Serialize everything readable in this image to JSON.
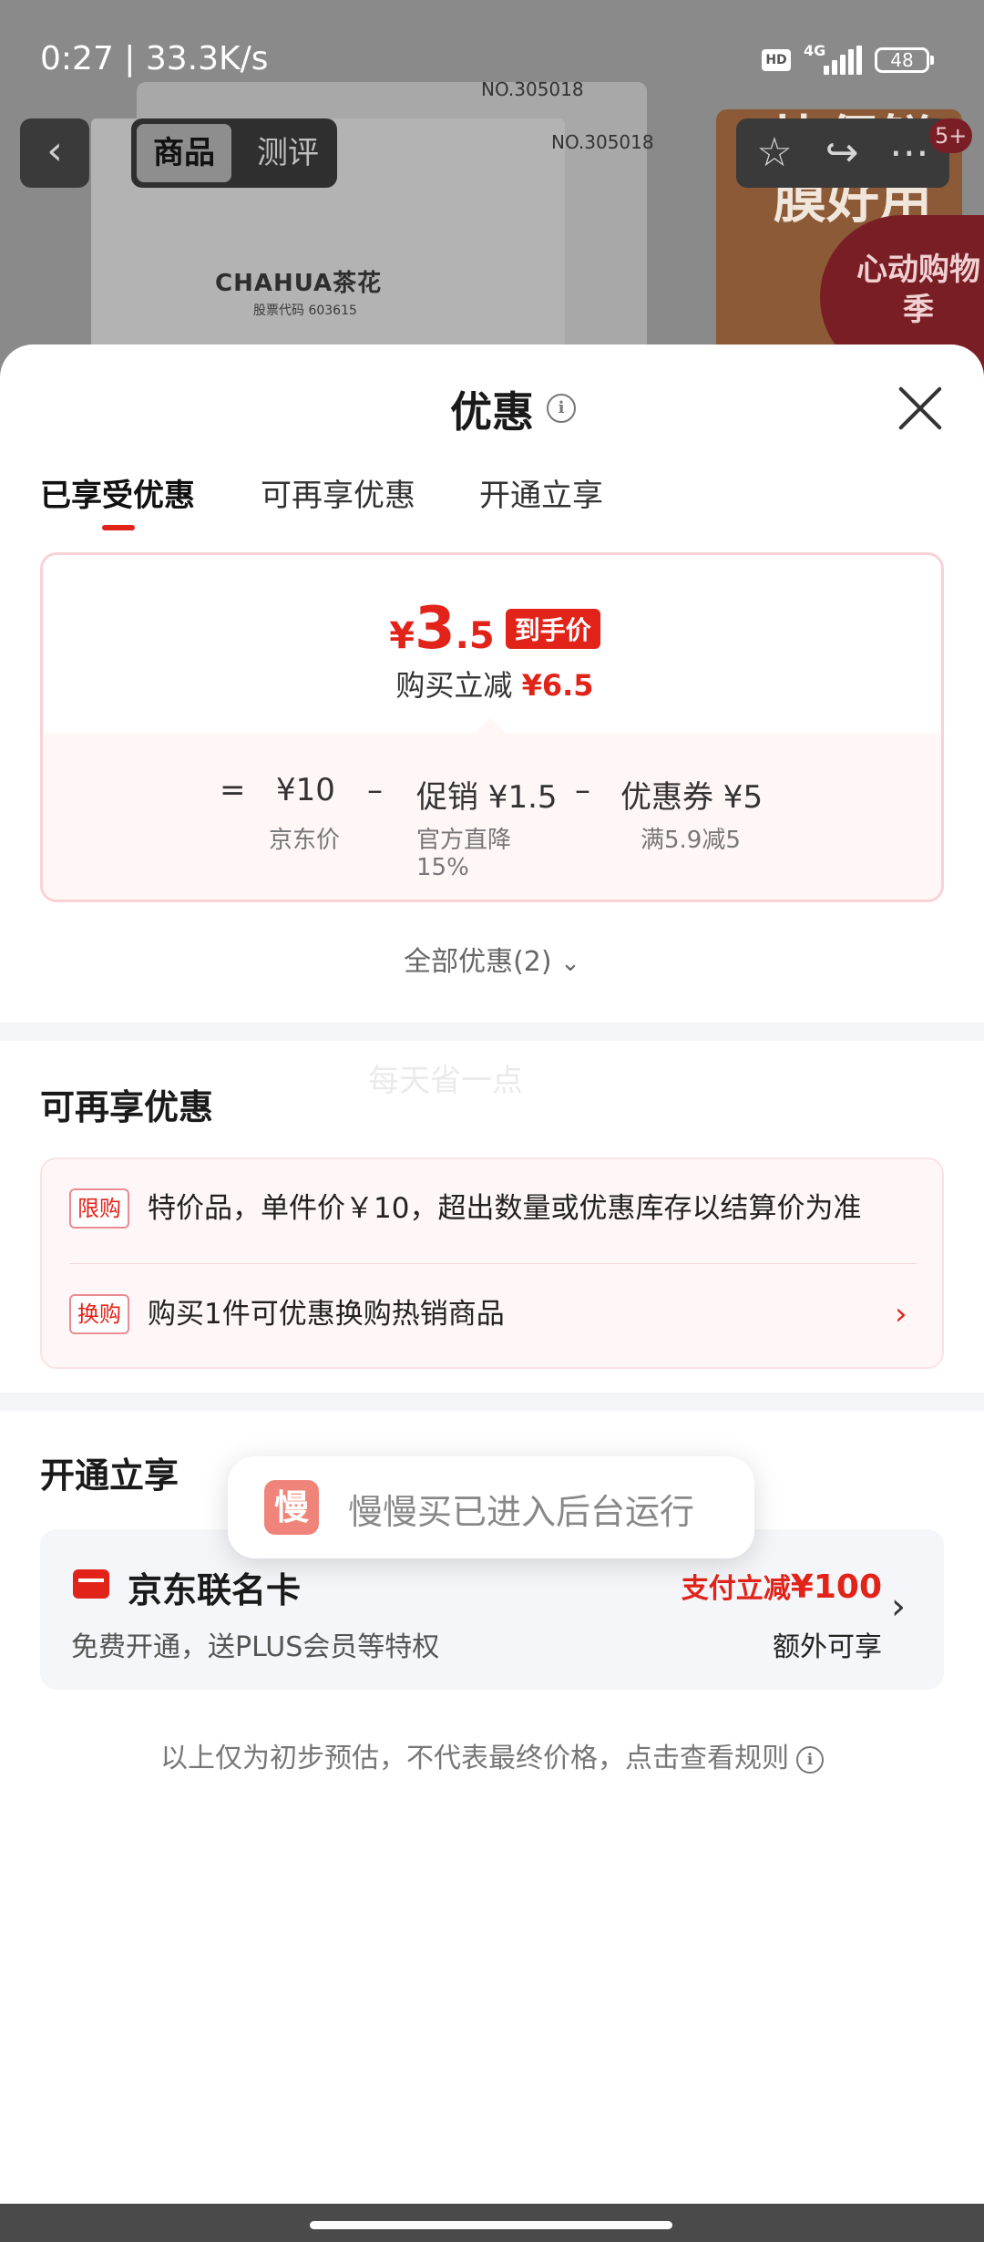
{
  "status_bar": {
    "time": "0:27 | 33.3K/s",
    "hd": "HD",
    "network": "4G",
    "battery": "48"
  },
  "background_page": {
    "product_no_1": "NO.305018",
    "product_no_2": "NO.305018",
    "brand": "CHAHUA茶花",
    "stock_code": "股票代码 603615",
    "ad_text": "比保鲜膜好用",
    "ad_badge": "心动购物季",
    "nav_tabs": [
      "商品",
      "测评"
    ],
    "cart_badge": "5+"
  },
  "sheet": {
    "title": "优惠",
    "tabs": [
      "已享受优惠",
      "可再享优惠",
      "开通立享"
    ],
    "price_card": {
      "yen": "¥",
      "price_int": "3",
      "price_dec": ".5",
      "badge": "到手价",
      "sub_label": "购买立减",
      "sub_amount": "¥6.5",
      "equals": "=",
      "minus": "–",
      "jd_price": "¥10",
      "jd_price_label": "京东价",
      "promo": "促销 ¥1.5",
      "promo_label_1": "官方直降",
      "promo_label_2": "15%",
      "coupon": "优惠券 ¥5",
      "coupon_label": "满5.9减5"
    },
    "all_offers": "全部优惠(2)",
    "watermark": "每天省一点",
    "more_offers": {
      "title": "可再享优惠",
      "items": [
        {
          "tag": "限购",
          "text": "特价品，单件价￥10，超出数量或优惠库存以结算价为准"
        },
        {
          "tag": "换购",
          "text": "购买1件可优惠换购热销商品"
        }
      ]
    },
    "activate": {
      "title": "开通立享",
      "card_name": "京东联名卡",
      "card_desc": "免费开通，送PLUS会员等特权",
      "pay_label": "支付立减",
      "pay_amount": "¥100",
      "extra": "额外可享"
    },
    "disclaimer": "以上仅为初步预估，不代表最终价格，点击查看规则"
  },
  "toast": {
    "icon_char": "慢",
    "text": "慢慢买已进入后台运行"
  },
  "colors": {
    "accent": "#e2231a",
    "tab_underline": "#e2231a",
    "toast_icon": "#f0847a"
  }
}
